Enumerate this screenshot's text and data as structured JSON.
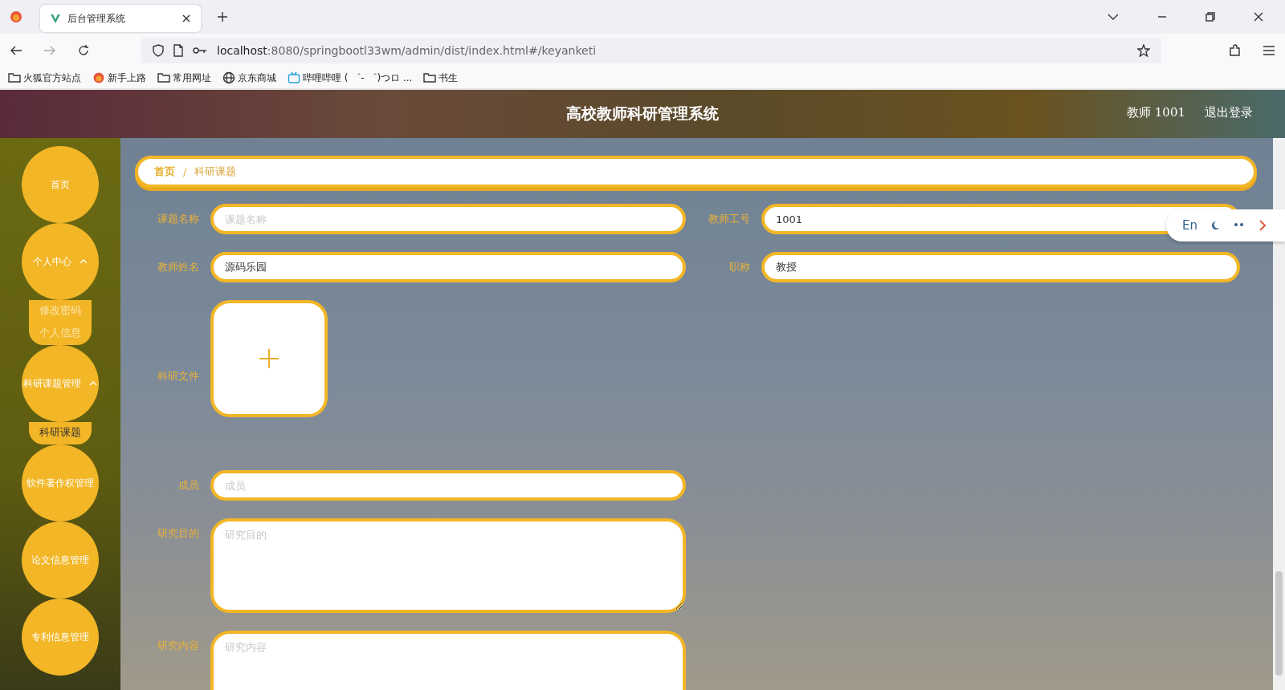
{
  "browser": {
    "tabs": [
      {
        "title": "后台管理系统",
        "selected": true
      }
    ],
    "address": {
      "host": "localhost",
      "path": ":8080/springbootl33wm/admin/dist/index.html#/keyanketi"
    },
    "bookmarks": [
      {
        "label": "火狐官方站点",
        "kind": "folder"
      },
      {
        "label": "新手上路",
        "kind": "firefox"
      },
      {
        "label": "常用网址",
        "kind": "folder"
      },
      {
        "label": "京东商城",
        "kind": "globe"
      },
      {
        "label": "哔哩哔哩 ( ゜- ゜)つロ ...",
        "kind": "tv"
      },
      {
        "label": "书生",
        "kind": "folder"
      }
    ]
  },
  "header": {
    "title": "高校教师科研管理系统",
    "user": "教师 1001",
    "logout": "退出登录"
  },
  "sidebar": {
    "items": [
      {
        "label": "首页"
      },
      {
        "label": "个人中心",
        "expanded": true,
        "children": [
          {
            "label": "修改密码",
            "selected": false
          },
          {
            "label": "个人信息",
            "selected": false
          }
        ]
      },
      {
        "label": "科研课题管理",
        "expanded": true,
        "children": [
          {
            "label": "科研课题",
            "selected": true
          }
        ]
      },
      {
        "label": "软件著作权管理"
      },
      {
        "label": "论文信息管理"
      },
      {
        "label": "专利信息管理"
      }
    ]
  },
  "breadcrumb": [
    {
      "label": "首页",
      "current": false
    },
    {
      "label": "/",
      "current": false
    },
    {
      "label": "科研课题",
      "current": true
    }
  ],
  "form": {
    "rows": [
      [
        {
          "label": "课题名称",
          "kind": "input",
          "placeholder": "课题名称"
        },
        {
          "label": "教师工号",
          "kind": "input",
          "value": "1001"
        }
      ],
      [
        {
          "label": "教师姓名",
          "kind": "input",
          "value": "源码乐园"
        },
        {
          "label": "职称",
          "kind": "input",
          "value": "教授"
        }
      ],
      [
        {
          "label": "科研文件",
          "kind": "upload"
        }
      ],
      [
        {
          "label": "成员",
          "kind": "input",
          "placeholder": "成员"
        }
      ],
      [
        {
          "label": "研究目的",
          "kind": "textarea",
          "placeholder": "研究目的"
        }
      ],
      [
        {
          "label": "研究内容",
          "kind": "textarea",
          "placeholder": "研究内容"
        }
      ]
    ]
  },
  "translate_bar": {
    "language": "En"
  }
}
